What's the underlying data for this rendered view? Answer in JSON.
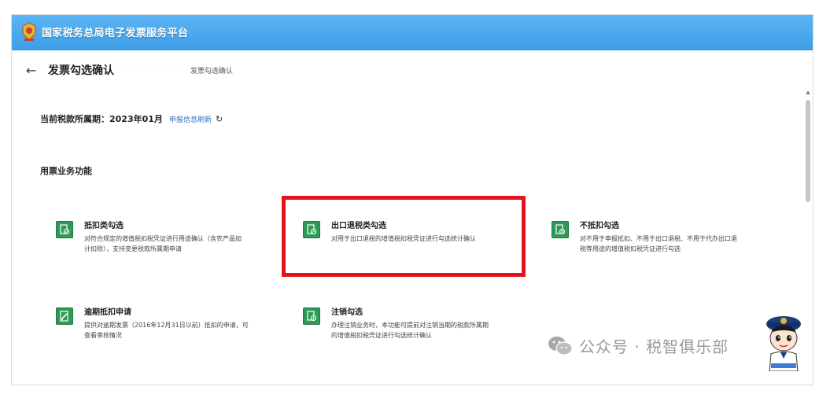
{
  "header": {
    "app_title": "国家税务总局电子发票服务平台",
    "emblem_icon": "tax-emblem-icon",
    "bar_color": "#4aa8ee"
  },
  "breadcrumb": {
    "back_icon": "←",
    "page_title": "发票勾选确认",
    "current": "发票勾选确认"
  },
  "period": {
    "label": "当前税款所属期：2023年01月",
    "refresh_link": "申报信息刷新",
    "refresh_icon": "↻"
  },
  "section": {
    "title": "用票业务功能"
  },
  "cards": [
    {
      "title": "抵扣类勾选",
      "desc_line1": "对符合规定的增值税扣税凭证进行用途确认（含农产品加",
      "desc_line2": "计扣除），支持变更税款所属期申请",
      "icon": "invoice-check-icon"
    },
    {
      "title": "出口退税类勾选",
      "desc_line1": "对用于出口退税的增值税扣税凭证进行勾选统计确认",
      "desc_line2": "",
      "icon": "export-refund-icon"
    },
    {
      "title": "不抵扣勾选",
      "desc_line1": "对不用于申报抵扣、不用于出口退税、不用于代办出口退",
      "desc_line2": "税等用途的增值税扣税凭证进行勾选",
      "icon": "no-deduct-icon"
    },
    {
      "title": "逾期抵扣申请",
      "desc_line1": "提供对逾期发票（2016年12月31日以前）抵扣的申请，可",
      "desc_line2": "查看审核情况",
      "icon": "overdue-apply-icon"
    },
    {
      "title": "注销勾选",
      "desc_line1": "办理注销业务时，本功能可提前对注销当期的税款所属期",
      "desc_line2": "的增值税扣税凭证进行勾选统计确认",
      "icon": "cancel-select-icon"
    }
  ],
  "colors": {
    "card_icon": "#2f9a57",
    "highlight": "#e5141c",
    "link": "#2f6fc2"
  },
  "watermark": {
    "text": "公众号 · 税智俱乐部",
    "icon": "wechat-icon"
  }
}
